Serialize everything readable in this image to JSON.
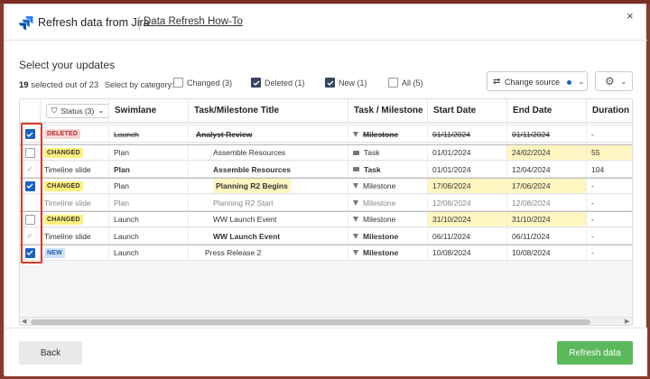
{
  "header": {
    "title": "Refresh data from Jira",
    "howto_link": "Data Refresh How-To",
    "close": "×"
  },
  "selection": {
    "subtitle": "Select your updates",
    "count_num": "19",
    "count_text": "selected out of 23",
    "by_category": "Select by category:",
    "categories": [
      {
        "label": "Changed (3)",
        "checked": false
      },
      {
        "label": "Deleted (1)",
        "checked": true
      },
      {
        "label": "New (1)",
        "checked": true
      },
      {
        "label": "All (5)",
        "checked": false
      }
    ],
    "change_source": "Change source"
  },
  "table": {
    "columns": {
      "status": "Status (3)",
      "swimlane": "Swimlane",
      "title": "Task/Milestone Title",
      "type": "Task / Milestone",
      "start": "Start Date",
      "end": "End Date",
      "duration": "Duration (d"
    },
    "rows": [
      {
        "checked": true,
        "badge": "DELETED",
        "swimlane": "Launch",
        "title": "Analyst Review",
        "type": "Milestone",
        "start": "01/11/2024",
        "end": "01/11/2024",
        "duration": "-"
      },
      {
        "checked": false,
        "badge": "CHANGED",
        "swimlane": "Plan",
        "title": "Assemble Resources",
        "type": "Task",
        "start": "01/01/2024",
        "end": "24/02/2024",
        "duration": "55"
      },
      {
        "checked": null,
        "badge": "Timeline slide",
        "swimlane": "Plan",
        "title": "Assemble Resources",
        "type": "Task",
        "start": "01/01/2024",
        "end": "12/04/2024",
        "duration": "104"
      },
      {
        "checked": true,
        "badge": "CHANGED",
        "swimlane": "Plan",
        "title": "Planning R2 Begins",
        "type": "Milestone",
        "start": "17/06/2024",
        "end": "17/06/2024",
        "duration": "-"
      },
      {
        "checked": null,
        "badge": "Timeline slide",
        "swimlane": "Plan",
        "title": "Planning R2 Start",
        "type": "Milestone",
        "start": "12/08/2024",
        "end": "12/08/2024",
        "duration": "-"
      },
      {
        "checked": false,
        "badge": "CHANGED",
        "swimlane": "Launch",
        "title": "WW Launch Event",
        "type": "Milestone",
        "start": "31/10/2024",
        "end": "31/10/2024",
        "duration": "-"
      },
      {
        "checked": null,
        "badge": "Timeline slide",
        "swimlane": "Launch",
        "title": "WW Launch Event",
        "type": "Milestone",
        "start": "06/11/2024",
        "end": "06/11/2024",
        "duration": "-"
      },
      {
        "checked": true,
        "badge": "NEW",
        "swimlane": "Launch",
        "title": "Press Release 2",
        "type": "Milestone",
        "start": "10/08/2024",
        "end": "10/08/2024",
        "duration": "-"
      }
    ]
  },
  "footer": {
    "back": "Back",
    "refresh": "Refresh data"
  },
  "colors": {
    "accent_blue": "#1a63c4",
    "refresh_green": "#5cb85c",
    "highlight_box": "#d73a2b",
    "changed_yellow": "#fff6c2"
  }
}
